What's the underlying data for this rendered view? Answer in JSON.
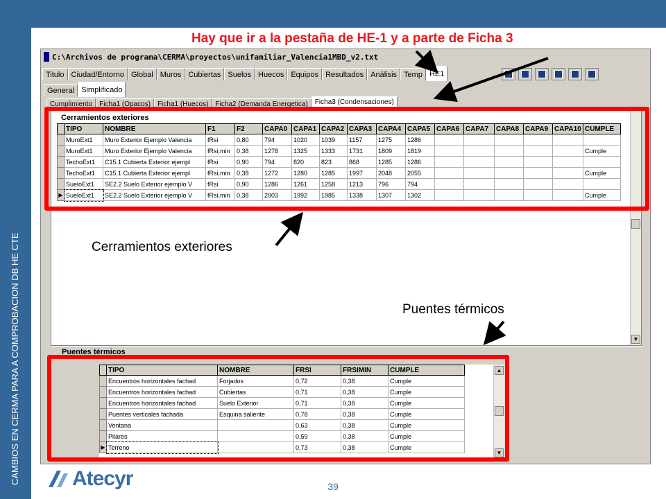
{
  "slide": {
    "headline": "Hay que ir a la pestaña de HE-1 y a parte de Ficha 3",
    "side_text": "CAMBIOS EN CERMA PARA A COMPROBACION DB HE CTE",
    "page_number": "39",
    "logo_text": "Atecyr",
    "callout_cerramientos": "Cerramientos exteriores",
    "callout_puentes": "Puentes térmicos",
    "accent_color": "#336699",
    "highlight_color": "#ff0000"
  },
  "window": {
    "title": "C:\\Archivos de programa\\CERMA\\proyectos\\unifamiliar_Valencia1MBD_v2.txt",
    "main_tabs": [
      "Titulo",
      "Ciudad/Entorno",
      "Global",
      "Muros",
      "Cubiertas",
      "Suelos",
      "Huecos",
      "Equipos",
      "Resultados",
      "Análisis",
      "Temp",
      "HE1"
    ],
    "sub_tabs": [
      "General",
      "Simplificado"
    ],
    "ficha_tabs": [
      "Cumplimiento",
      "Ficha1 (Opacos)",
      "Ficha1 (Huecos)",
      "Ficha2 (Demanda Energetica)",
      "Ficha3 (Condensaciones)"
    ]
  },
  "cerramientos": {
    "title": "Cerramientos exteriores",
    "columns": [
      "TIPO",
      "NOMBRE",
      "F1",
      "F2",
      "CAPA0",
      "CAPA1",
      "CAPA2",
      "CAPA3",
      "CAPA4",
      "CAPA5",
      "CAPA6",
      "CAPA7",
      "CAPA8",
      "CAPA9",
      "CAPA10",
      "CUMPLE"
    ],
    "rows": [
      [
        "MuroExt1",
        "Muro Exterior Ejemplo Valencia",
        "fRsi",
        "0,80",
        "794",
        "1020",
        "1039",
        "1157",
        "1275",
        "1286",
        "",
        "",
        "",
        "",
        "",
        ""
      ],
      [
        "MuroExt1",
        "Muro Exterior Ejemplo Valencia",
        "fRsi,min",
        "0,38",
        "1278",
        "1325",
        "1333",
        "1731",
        "1809",
        "1819",
        "",
        "",
        "",
        "",
        "",
        "Cumple"
      ],
      [
        "TechoExt1",
        "C15.1 Cubierta Exterior ejempl",
        "fRsi",
        "0,90",
        "794",
        "820",
        "823",
        "868",
        "1285",
        "1286",
        "",
        "",
        "",
        "",
        "",
        ""
      ],
      [
        "TechoExt1",
        "C15.1 Cubierta Exterior ejempl",
        "fRsi,min",
        "0,38",
        "1272",
        "1280",
        "1285",
        "1997",
        "2048",
        "2055",
        "",
        "",
        "",
        "",
        "",
        "Cumple"
      ],
      [
        "SueloExt1",
        "SE2.2 Suelo Exterior ejemplo V",
        "fRsi",
        "0,90",
        "1286",
        "1261",
        "1258",
        "1213",
        "796",
        "794",
        "",
        "",
        "",
        "",
        "",
        ""
      ],
      [
        "SueloExt1",
        "SE2.2 Suelo Exterior ejemplo V",
        "fRsi,min",
        "0,38",
        "2003",
        "1992",
        "1985",
        "1338",
        "1307",
        "1302",
        "",
        "",
        "",
        "",
        "",
        "Cumple"
      ]
    ]
  },
  "puentes": {
    "title": "Puentes térmicos",
    "columns": [
      "TIPO",
      "NOMBRE",
      "FRSI",
      "FRSIMIN",
      "CUMPLE"
    ],
    "rows": [
      [
        "Encuentros horizontales fachad",
        "Forjados",
        "0,72",
        "0,38",
        "Cumple"
      ],
      [
        "Encuentros horizontales fachad",
        "Cubiertas",
        "0,71",
        "0,38",
        "Cumple"
      ],
      [
        "Encuentros horizontales fachad",
        "Suelo Exterior",
        "0,71",
        "0,38",
        "Cumple"
      ],
      [
        "Puentes verticales fachada",
        "Esquina saliente",
        "0,78",
        "0,38",
        "Cumple"
      ],
      [
        "Ventana",
        "",
        "0,63",
        "0,38",
        "Cumple"
      ],
      [
        "Pilares",
        "",
        "0,59",
        "0,38",
        "Cumple"
      ],
      [
        "Terreno",
        "",
        "0,73",
        "0,38",
        "Cumple"
      ]
    ]
  }
}
